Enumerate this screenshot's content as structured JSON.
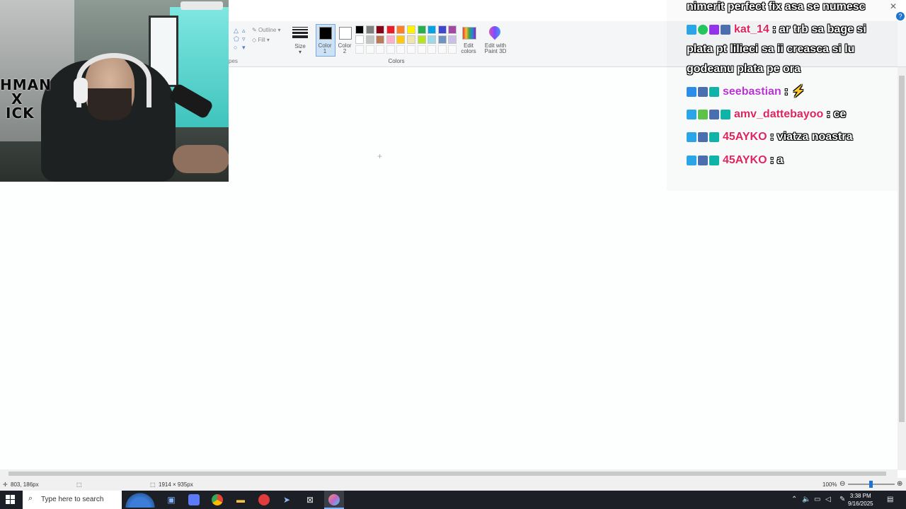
{
  "ribbon": {
    "shapes_group_label": "pes",
    "outline_label": "Outline",
    "fill_label": "Fill",
    "size_label": "Size",
    "color1_label": "Color",
    "color1_sub": "1",
    "color2_label": "Color",
    "color2_sub": "2",
    "colors_group_label": "Colors",
    "edit_colors_label": "Edit",
    "edit_colors_sub": "colors",
    "paint3d_label": "Edit with",
    "paint3d_sub": "Paint 3D",
    "swatches_row1": [
      "#000000",
      "#7f7f7f",
      "#880015",
      "#ed1c24",
      "#ff7f27",
      "#fff200",
      "#22b14c",
      "#00a2e8",
      "#3f48cc",
      "#a349a4"
    ],
    "swatches_row2": [
      "#ffffff",
      "#c3c3c3",
      "#b97a57",
      "#ffaec9",
      "#ffc90e",
      "#efe4b0",
      "#b5e61d",
      "#99d9ea",
      "#7092be",
      "#c8bfe7"
    ]
  },
  "statusbar": {
    "cursor_pos": "803, 186px",
    "canvas_size": "1914 × 935px",
    "zoom": "100%"
  },
  "taskbar": {
    "search_placeholder": "Type here to search",
    "time": "3:38 PM",
    "date": "9/16/2025"
  },
  "webcam": {
    "poster_text_line1": "HMAN",
    "poster_text_line2": "X",
    "poster_text_line3": "ICK"
  },
  "chat": {
    "messages": [
      {
        "user": "",
        "text": "nimerit perfect fix asa se numesc"
      },
      {
        "user": "kat_14",
        "user_color": "#e0245e",
        "text": ": ar trb sa bage si plata pt lilieci sa ii creasca si lu godeanu plata pe ora"
      },
      {
        "user": "seebastian",
        "user_color": "#b833d6",
        "text": ":"
      },
      {
        "user": "amv_dattebayoo",
        "user_color": "#e0245e",
        "text": ": ce"
      },
      {
        "user": "45AYKO",
        "user_color": "#e0245e",
        "text": ": viatza noastra"
      },
      {
        "user": "45AYKO",
        "user_color": "#e0245e",
        "text": ": a"
      }
    ]
  }
}
